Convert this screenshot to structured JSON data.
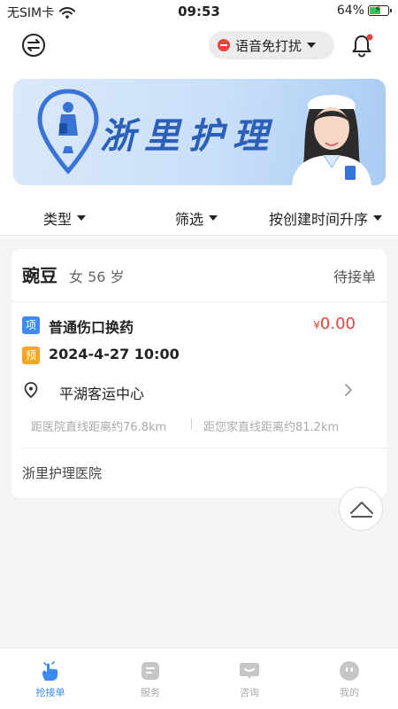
{
  "status_bar": {
    "carrier": "无SIM卡",
    "time": "09:53",
    "battery": "64%",
    "battery_level": 0.64
  },
  "header": {
    "dnd_label": "语音免打扰"
  },
  "banner": {
    "title": "浙里护理"
  },
  "filters": {
    "type": "类型",
    "filter": "筛选",
    "sort": "按创建时间升序"
  },
  "order": {
    "patient_name": "豌豆",
    "patient_info": "女 56 岁",
    "status": "待接单",
    "tag_service": "项",
    "service_name": "普通伤口换药",
    "price_symbol": "¥",
    "price_value": "0.00",
    "tag_appointment": "预",
    "appointment_time": "2024-4-27 10:00",
    "location": "平湖客运中心",
    "distance_hospital": "距医院直线距离约76.8km",
    "distance_home": "距您家直线距离约81.2km",
    "hospital": "浙里护理医院"
  },
  "tabs": [
    {
      "label": "抢接单",
      "active": true
    },
    {
      "label": "服务",
      "active": false
    },
    {
      "label": "咨询",
      "active": false
    },
    {
      "label": "我的",
      "active": false
    }
  ],
  "colors": {
    "accent": "#3d8bf2",
    "price": "#e8433a",
    "tag_orange": "#f5a623"
  }
}
